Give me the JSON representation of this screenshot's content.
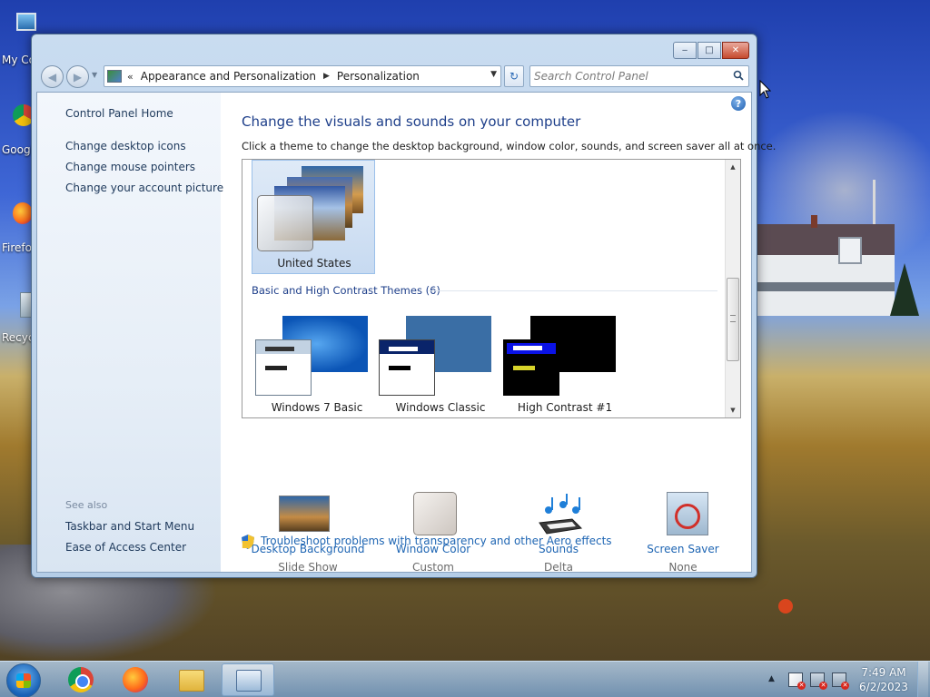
{
  "desktop": {
    "icons": [
      {
        "label": "My Computer",
        "icon": "computer-icon"
      },
      {
        "label": "Google Chrome",
        "icon": "chrome-icon"
      },
      {
        "label": "Firefox",
        "icon": "firefox-icon"
      },
      {
        "label": "Recycle Bin",
        "icon": "recycle-bin-icon"
      }
    ]
  },
  "window": {
    "caption_buttons": {
      "minimize": "‒",
      "maximize": "□",
      "close": "✕"
    },
    "address": {
      "chevrons": "«",
      "crumbs": [
        "Appearance and Personalization",
        "Personalization"
      ],
      "separator": "▶",
      "dropdown": "▼"
    },
    "refresh_glyph": "↻",
    "search": {
      "placeholder": "Search Control Panel"
    },
    "help_glyph": "?"
  },
  "sidebar": {
    "home": "Control Panel Home",
    "links": [
      "Change desktop icons",
      "Change mouse pointers",
      "Change your account picture"
    ],
    "see_also_label": "See also",
    "see_also": [
      "Taskbar and Start Menu",
      "Ease of Access Center"
    ]
  },
  "main": {
    "title": "Change the visuals and sounds on your computer",
    "description": "Click a theme to change the desktop background, window color, sounds, and screen saver all at once.",
    "selected_theme": "United States",
    "basic_section": "Basic and High Contrast Themes (6)",
    "basic_themes": [
      "Windows 7 Basic",
      "Windows Classic",
      "High Contrast #1"
    ],
    "scroll": {
      "up": "▲",
      "down": "▼"
    },
    "settings": [
      {
        "title": "Desktop Background",
        "value": "Slide Show",
        "icon": "desktop-background-icon"
      },
      {
        "title": "Window Color",
        "value": "Custom",
        "icon": "window-color-icon"
      },
      {
        "title": "Sounds",
        "value": "Delta",
        "icon": "sounds-icon"
      },
      {
        "title": "Screen Saver",
        "value": "None",
        "icon": "screen-saver-icon"
      }
    ],
    "troubleshoot": "Troubleshoot problems with transparency and other Aero effects"
  },
  "taskbar": {
    "apps": [
      "chrome-icon",
      "firefox-icon",
      "file-explorer-icon",
      "control-panel-icon"
    ],
    "tray_up": "▲",
    "tray_x": "✕",
    "time": "7:49 AM",
    "date": "6/2/2023"
  },
  "colors": {
    "link": "#1e65b3",
    "title": "#1e3f8a",
    "sidebar_link": "#1e395b",
    "selection": "#c7daf1"
  }
}
